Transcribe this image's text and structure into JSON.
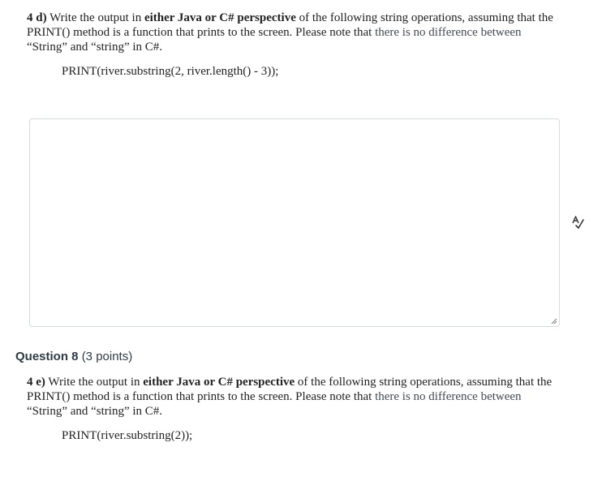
{
  "question7": {
    "prompt": {
      "label": "4 d)",
      "text_a": " Write the output in ",
      "emphasis": "either Java or C# perspective",
      "text_b": " of the following string operations, assuming that the PRINT() method is a function that prints to the screen. Please note that ",
      "muted": "there is no difference between",
      "text_c": " “String” and “string” in C#."
    },
    "code": "PRINT(river.substring(2, river.length() - 3));",
    "answer_value": ""
  },
  "spell_check_icon": "spell-check-icon",
  "question8": {
    "title": "Question 8",
    "points": "(3 points)",
    "prompt": {
      "label": "4 e)",
      "text_a": " Write the output in ",
      "emphasis": "either Java or C# perspective",
      "text_b": " of the following string operations, assuming that the PRINT() method is a function that prints to the screen. Please note that ",
      "muted": "there is no difference between",
      "text_c": " “String” and “string” in C#."
    },
    "code": "PRINT(river.substring(2));"
  },
  "colors": {
    "text": "#222222",
    "heading": "#2d3b45",
    "border": "#d7dbe0",
    "muted": "#444a55"
  }
}
